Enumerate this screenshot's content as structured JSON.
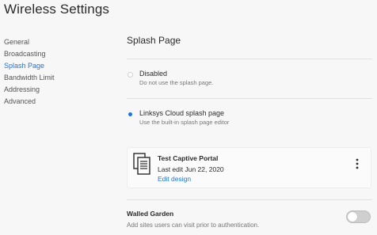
{
  "page": {
    "title": "Wireless Settings"
  },
  "sidebar": {
    "items": [
      {
        "label": "General",
        "active": false
      },
      {
        "label": "Broadcasting",
        "active": false
      },
      {
        "label": "Splash Page",
        "active": true
      },
      {
        "label": "Bandwidth Limit",
        "active": false
      },
      {
        "label": "Addressing",
        "active": false
      },
      {
        "label": "Advanced",
        "active": false
      }
    ]
  },
  "splash": {
    "section_title": "Splash Page",
    "options": [
      {
        "label": "Disabled",
        "description": "Do not use the splash page.",
        "selected": false
      },
      {
        "label": "Linksys Cloud splash page",
        "description": "Use the built-in splash page editor",
        "selected": true
      }
    ],
    "portal": {
      "icon": "document-stack-icon",
      "name": "Test Captive Portal",
      "last_edit": "Last edit Jun 22, 2020",
      "edit_link": "Edit design",
      "menu_icon": "kebab-menu-icon"
    }
  },
  "walled_garden": {
    "title": "Walled Garden",
    "description": "Add sites users can visit prior to authentication.",
    "enabled": false
  },
  "colors": {
    "accent": "#2174d4",
    "background": "#f7f7f7",
    "muted_text": "#777777",
    "toggle_off": "#cfcfcf"
  }
}
